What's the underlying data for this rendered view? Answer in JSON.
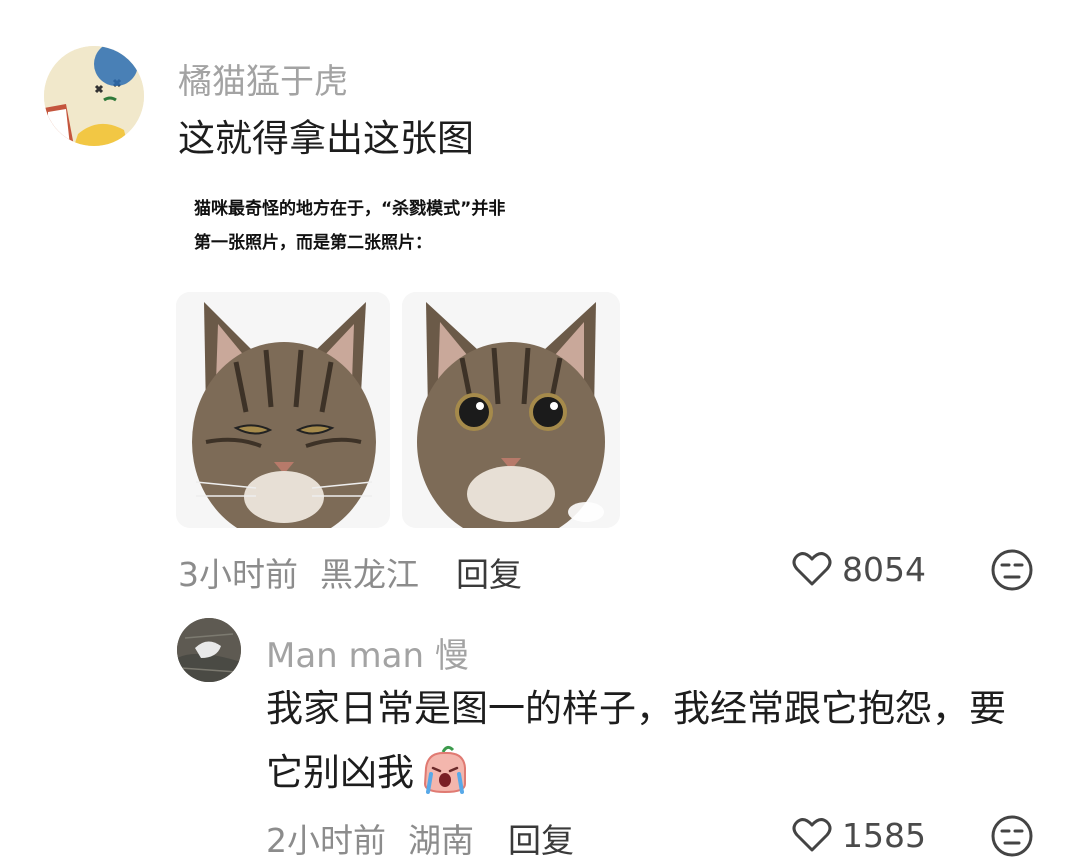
{
  "comment": {
    "username": "橘猫猛于虎",
    "text": "这就得拿出这张图",
    "meme": {
      "caption_line1": "猫咪最奇怪的地方在于，“杀戮模式”并非",
      "caption_line2": "第一张照片，而是第二张照片："
    },
    "time": "3小时前",
    "location": "黑龙江",
    "reply_label": "回复",
    "likes": "8054"
  },
  "reply": {
    "username": "Man man 慢",
    "text_line1": "我家日常是图一的样子，我经常跟它抱怨，要",
    "text_line2": "它别凶我",
    "time": "2小时前",
    "location": "湖南",
    "reply_label": "回复",
    "likes": "1585"
  },
  "icons": {
    "like": "heart-outline-icon",
    "dislike": "meh-face-icon",
    "emoji": "crying-face-emoji"
  }
}
